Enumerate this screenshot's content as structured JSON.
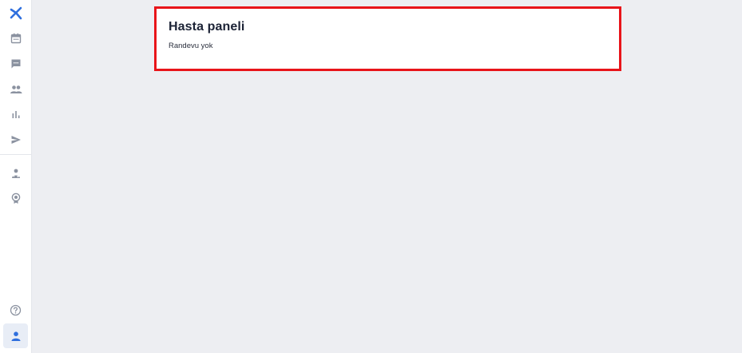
{
  "sidebar": {
    "logo": {
      "icon": "brand-logo-icon",
      "color": "#2f6fde"
    },
    "items": [
      {
        "name": "calendar",
        "icon": "calendar-icon"
      },
      {
        "name": "messages",
        "icon": "chat-icon"
      },
      {
        "name": "patients",
        "icon": "people-icon"
      },
      {
        "name": "statistics",
        "icon": "bar-chart-icon"
      },
      {
        "name": "send",
        "icon": "send-icon"
      },
      {
        "name": "doctors",
        "icon": "doctor-icon"
      },
      {
        "name": "awards",
        "icon": "badge-icon"
      }
    ],
    "bottom": [
      {
        "name": "help",
        "icon": "help-icon"
      },
      {
        "name": "account",
        "icon": "user-icon",
        "active": true
      }
    ],
    "icon_color": "#8b92a0",
    "active_color": "#2f6fde"
  },
  "panel": {
    "title": "Hasta paneli",
    "empty_text": "Randevu yok",
    "highlight_color": "#e8141a"
  }
}
